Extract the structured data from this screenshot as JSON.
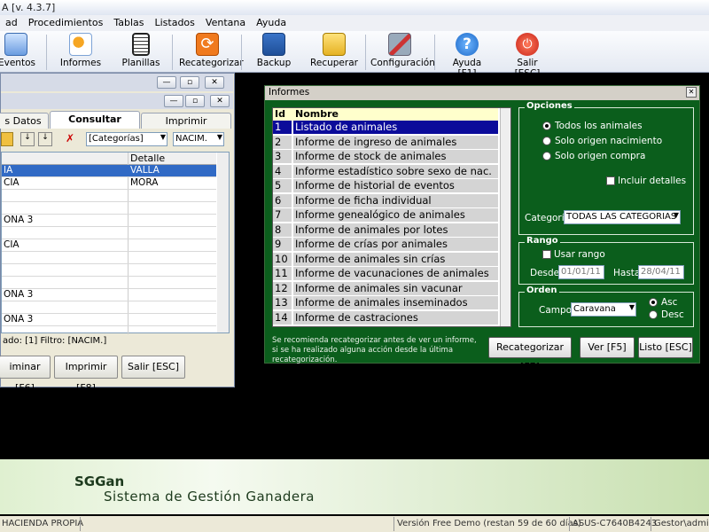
{
  "app": {
    "title": "A [v. 4.3.7]"
  },
  "menu": [
    "ad",
    "Procedimientos",
    "Tablas",
    "Listados",
    "Ventana",
    "Ayuda"
  ],
  "toolbar": [
    {
      "label": "Eventos",
      "icon": "events-icon"
    },
    {
      "label": "Informes",
      "icon": "reports-icon"
    },
    {
      "label": "Planillas",
      "icon": "sheets-icon"
    },
    {
      "label": "Recategorizar",
      "icon": "recategorize-icon"
    },
    {
      "label": "Backup",
      "icon": "backup-icon"
    },
    {
      "label": "Recuperar",
      "icon": "restore-icon"
    },
    {
      "label": "Configuración",
      "icon": "settings-icon"
    },
    {
      "label": "Ayuda [F1]",
      "icon": "help-icon"
    },
    {
      "label": "Salir [ESC]",
      "icon": "exit-icon"
    }
  ],
  "left": {
    "tabs": [
      "s Datos",
      "Consultar",
      "Imprimir"
    ],
    "filter_combo": "[Categorías]",
    "sort_combo": "NACIM.",
    "col_detalle": "Detalle",
    "rows": [
      {
        "a": "IA",
        "b": "VALLA"
      },
      {
        "a": "CIA",
        "b": "MORA"
      },
      {
        "a": "",
        "b": ""
      },
      {
        "a": "",
        "b": ""
      },
      {
        "a": "ONA 3",
        "b": ""
      },
      {
        "a": "",
        "b": ""
      },
      {
        "a": "CIA",
        "b": ""
      },
      {
        "a": "",
        "b": ""
      },
      {
        "a": "",
        "b": ""
      },
      {
        "a": "",
        "b": ""
      },
      {
        "a": "ONA 3",
        "b": ""
      },
      {
        "a": "",
        "b": ""
      },
      {
        "a": "ONA 3",
        "b": ""
      }
    ],
    "status": "ado: [1]  Filtro: [NACIM.]",
    "btn_delete": "iminar [F6]",
    "btn_print": "Imprimir [F8]",
    "btn_exit": "Salir [ESC]"
  },
  "informes": {
    "title": "Informes",
    "col_id": "Id",
    "col_name": "Nombre",
    "items": [
      {
        "id": "1",
        "name": "Listado de animales"
      },
      {
        "id": "2",
        "name": "Informe de ingreso de animales"
      },
      {
        "id": "3",
        "name": "Informe de stock de animales"
      },
      {
        "id": "4",
        "name": "Informe estadístico sobre sexo de nac."
      },
      {
        "id": "5",
        "name": "Informe de historial de eventos"
      },
      {
        "id": "6",
        "name": "Informe de ficha individual"
      },
      {
        "id": "7",
        "name": "Informe genealógico de animales"
      },
      {
        "id": "8",
        "name": "Informe de animales por lotes"
      },
      {
        "id": "9",
        "name": "Informe de crías por animales"
      },
      {
        "id": "10",
        "name": "Informe de animales sin crías"
      },
      {
        "id": "11",
        "name": "Informe de vacunaciones de animales"
      },
      {
        "id": "12",
        "name": "Informe de animales sin vacunar"
      },
      {
        "id": "13",
        "name": "Informe de animales inseminados"
      },
      {
        "id": "14",
        "name": "Informe de castraciones"
      }
    ],
    "opciones_label": "Opciones",
    "opt_todos": "Todos los animales",
    "opt_nac": "Solo origen nacimiento",
    "opt_compra": "Solo origen compra",
    "incluir": "Incluir detalles",
    "categoria_label": "Categoría:",
    "categoria_value": "TODAS LAS CATEGORIAS",
    "rango_label": "Rango",
    "usar_rango": "Usar rango",
    "desde_label": "Desde:",
    "desde_value": "01/01/11",
    "hasta_label": "Hasta:",
    "hasta_value": "28/04/11",
    "orden_label": "Orden",
    "campo_label": "Campo:",
    "campo_value": "Caravana",
    "asc": "Asc",
    "desc": "Desc",
    "note": "Se recomienda recategorizar antes de ver un informe, si se ha realizado alguna acción desde la última recategorización.",
    "btn_recat": "Recategorizar [F7]",
    "btn_ver": "Ver [F5]",
    "btn_listo": "Listo [ESC]"
  },
  "banner": {
    "brand": "SGGan",
    "subtitle": "Sistema de Gestión Ganadera"
  },
  "statusbar": {
    "farm": "HACIENDA PROPIA",
    "version": "Versión Free Demo (restan 59 de 60 días)",
    "machine": "ASUS-C7640B4243",
    "user": "Gestor\\admin"
  }
}
